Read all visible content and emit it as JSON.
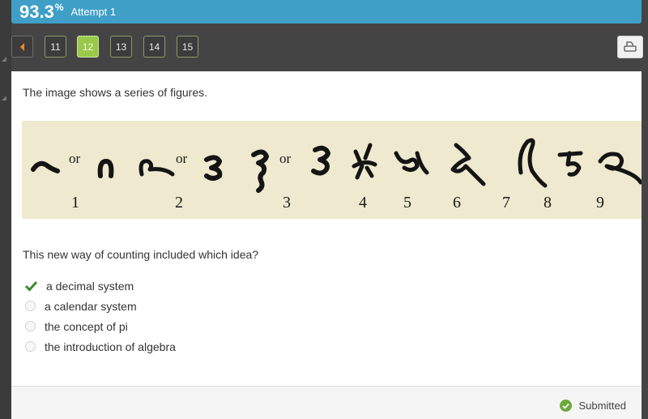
{
  "score": {
    "value": "93.3",
    "suffix": "%",
    "attempt_label": "Attempt 1"
  },
  "navigation": {
    "prev_icon": "caret-left-icon",
    "pages": [
      {
        "label": "11",
        "active": false
      },
      {
        "label": "12",
        "active": true
      },
      {
        "label": "13",
        "active": false
      },
      {
        "label": "14",
        "active": false
      },
      {
        "label": "15",
        "active": false
      }
    ],
    "print_icon": "printer-icon"
  },
  "content": {
    "intro": "The image shows a series of figures.",
    "figure": {
      "description": "Early Hindu/Brahmi numeral forms for 1 through 9",
      "glyph_groups": [
        {
          "numeral": "1",
          "alternates": 2,
          "connector": "or"
        },
        {
          "numeral": "2",
          "alternates": 2,
          "connector": "or"
        },
        {
          "numeral": "3",
          "alternates": 2,
          "connector": "or"
        },
        {
          "numeral": "4",
          "alternates": 1
        },
        {
          "numeral": "5",
          "alternates": 1
        },
        {
          "numeral": "6",
          "alternates": 1
        },
        {
          "numeral": "7",
          "alternates": 1
        },
        {
          "numeral": "8",
          "alternates": 1
        },
        {
          "numeral": "9",
          "alternates": 1
        }
      ],
      "labels": [
        "1",
        "2",
        "3",
        "4",
        "5",
        "6",
        "7",
        "8",
        "9"
      ],
      "or_text": "or"
    },
    "question": "This new way of counting included which idea?",
    "options": [
      {
        "label": "a decimal system",
        "state": "correct-selected"
      },
      {
        "label": "a calendar system",
        "state": "unselected"
      },
      {
        "label": "the concept of pi",
        "state": "unselected"
      },
      {
        "label": "the introduction of algebra",
        "state": "unselected"
      }
    ]
  },
  "footer": {
    "status": "Submitted",
    "status_icon": "check-circle-icon"
  },
  "colors": {
    "header": "#3f9fc7",
    "active_page": "#9ac94a",
    "check": "#3a8a2e",
    "status_ok": "#6aaa3a",
    "prev_arrow": "#e98a2e"
  }
}
